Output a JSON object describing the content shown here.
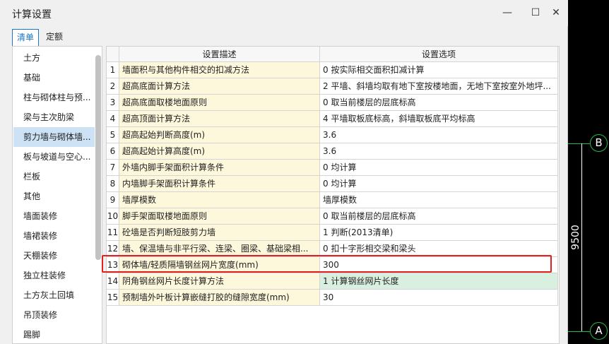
{
  "window": {
    "title": "计算设置",
    "minimize_icon": "—",
    "maximize_icon": "☐",
    "close_icon": "✕"
  },
  "tabs": [
    {
      "label": "清单",
      "active": true
    },
    {
      "label": "定额",
      "active": false
    }
  ],
  "sidebar": {
    "items": [
      {
        "label": "土方"
      },
      {
        "label": "基础"
      },
      {
        "label": "柱与砌体柱与预..."
      },
      {
        "label": "梁与主次肋梁"
      },
      {
        "label": "剪力墙与砌体墙...",
        "selected": true
      },
      {
        "label": "板与坡道与空心..."
      },
      {
        "label": "栏板"
      },
      {
        "label": "其他"
      },
      {
        "label": "墙面装修"
      },
      {
        "label": "墙裙装修"
      },
      {
        "label": "天棚装修"
      },
      {
        "label": "独立柱装修"
      },
      {
        "label": "土方灰土回填"
      },
      {
        "label": "吊顶装修"
      },
      {
        "label": "踢脚"
      }
    ]
  },
  "grid": {
    "headers": {
      "desc": "设置描述",
      "val": "设置选项"
    },
    "rows": [
      {
        "num": "1",
        "desc": "墙面积与其他构件相交的扣减方法",
        "val": "0 按实际相交面积扣减计算"
      },
      {
        "num": "2",
        "desc": "超高底面计算方法",
        "val": "2 平墙、斜墙均取有地下室按楼地面，无地下室按室外地坪..."
      },
      {
        "num": "3",
        "desc": "超高底面取楼地面原则",
        "val": "0 取当前楼层的层底标高"
      },
      {
        "num": "4",
        "desc": "超高顶面计算方法",
        "val": "4 平墙取板底标高，斜墙取板底平均标高"
      },
      {
        "num": "5",
        "desc": "超高起始判断高度(m)",
        "val": "3.6"
      },
      {
        "num": "6",
        "desc": "超高起始计算高度(m)",
        "val": "3.6"
      },
      {
        "num": "7",
        "desc": "外墙内脚手架面积计算条件",
        "val": "0 均计算"
      },
      {
        "num": "8",
        "desc": "内墙脚手架面积计算条件",
        "val": "0 均计算"
      },
      {
        "num": "9",
        "desc": "墙厚模数",
        "val": "墙厚模数"
      },
      {
        "num": "10",
        "desc": "脚手架面取楼地面原则",
        "val": "0 取当前楼层的层底标高"
      },
      {
        "num": "11",
        "desc": "砼墙是否判断短肢剪力墙",
        "val": "1 判断(2013清单)"
      },
      {
        "num": "12",
        "desc": "墙、保温墙与非平行梁、连梁、圈梁、基础梁相...",
        "val": "0 扣十字形相交梁和梁头"
      },
      {
        "num": "13",
        "desc": "砌体墙/轻质隔墙钢丝网片宽度(mm)",
        "val": "300"
      },
      {
        "num": "14",
        "desc": "阴角钢丝网片长度计算方法",
        "val": "1 计算钢丝网片长度",
        "green": true
      },
      {
        "num": "15",
        "desc": "预制墙外叶板计算嵌缝打胶的缝隙宽度(mm)",
        "val": "30"
      }
    ]
  },
  "cad": {
    "axis_b": "B",
    "axis_a": "A",
    "dimension": "9500",
    "line_color": "#27b84a"
  },
  "colors": {
    "accent": "#1e74c6",
    "selected_bg": "#cde2f5",
    "desc_bg": "#fdf8dc",
    "highlight_border": "#e32020"
  }
}
